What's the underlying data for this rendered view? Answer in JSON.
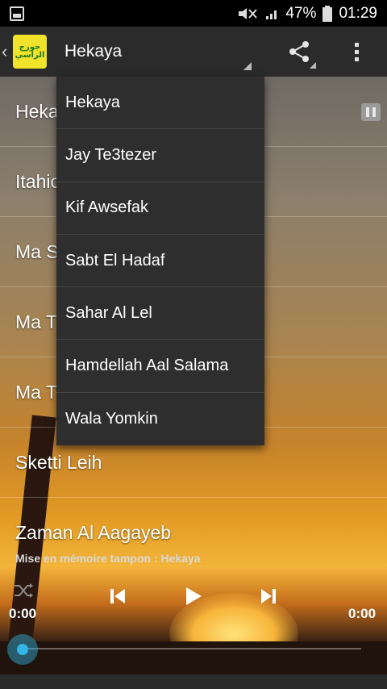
{
  "status_bar": {
    "battery": "47%",
    "time": "01:29",
    "icons": [
      "image-notification-icon",
      "mute-icon",
      "signal-icon",
      "battery-icon"
    ]
  },
  "action_bar": {
    "title": "Hekaya",
    "logo_text": "جورج الراسي",
    "icons": [
      "back-chevron-icon",
      "share-icon",
      "overflow-menu-icon"
    ]
  },
  "song_list": [
    "Heka",
    "Itahio",
    "Ma S",
    "Ma T",
    "Ma T",
    "Sketti Leih",
    "Zaman Al Aagayeb"
  ],
  "dropdown": {
    "items": [
      "Hekaya",
      "Jay Te3tezer",
      "Kif Awsefak",
      "Sabt El Hadaf",
      "Sahar Al Lel",
      "Hamdellah Aal Salama",
      "Wala Yomkin"
    ]
  },
  "player": {
    "buffer_label": "Mise en mémoire tampon : Hekaya",
    "time_elapsed": "0:00",
    "time_total": "0:00",
    "progress": 0,
    "icons": [
      "shuffle-icon",
      "previous-icon",
      "play-icon",
      "next-icon",
      "pause-icon"
    ]
  },
  "colors": {
    "accent": "#33b5e5",
    "action_bar": "#2b2b2b",
    "dropdown_bg": "#2e2e2e"
  }
}
